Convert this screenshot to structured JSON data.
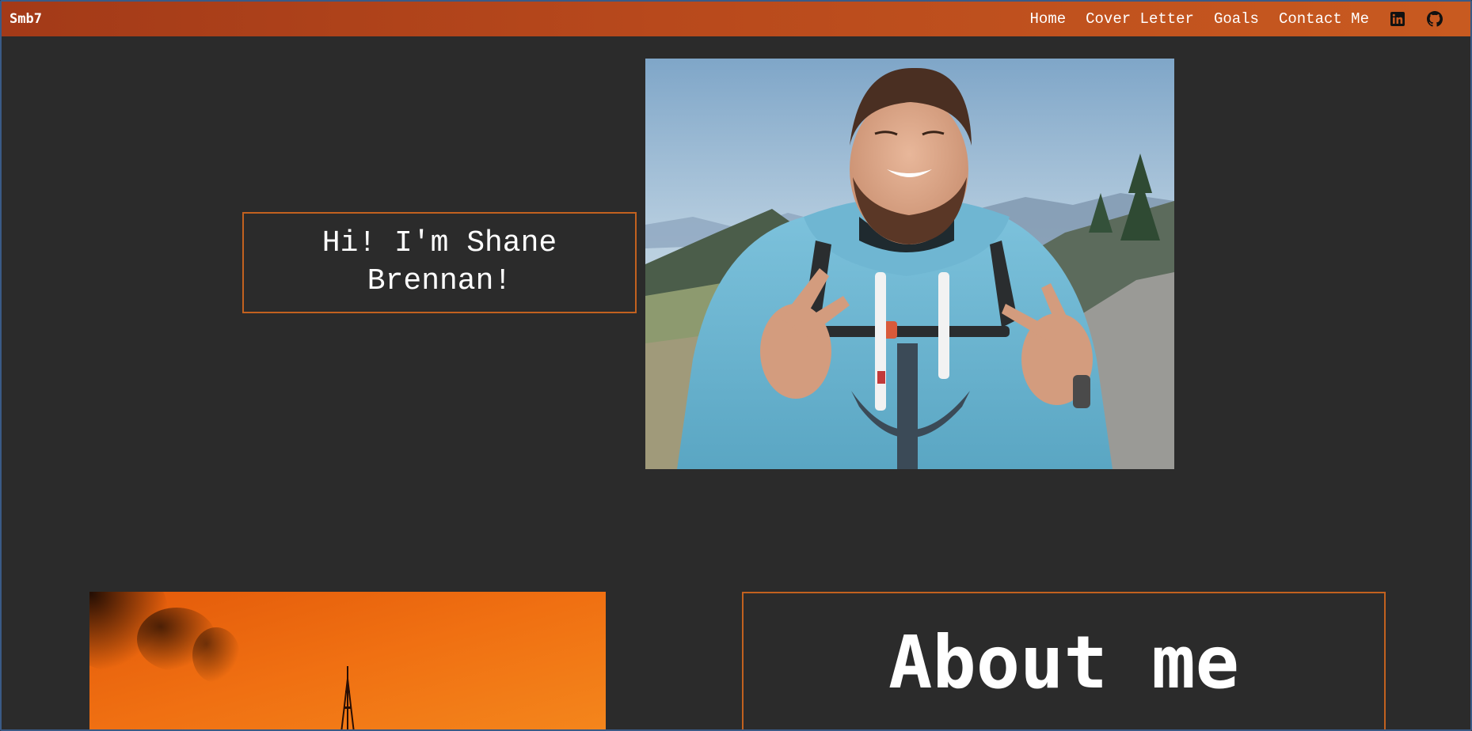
{
  "navbar": {
    "brand": "Smb7",
    "links": [
      "Home",
      "Cover Letter",
      "Goals",
      "Contact Me"
    ],
    "icons": [
      "linkedin-icon",
      "github-icon"
    ]
  },
  "hero": {
    "greeting": "Hi! I'm Shane Brennan!"
  },
  "about": {
    "title": "About me"
  },
  "colors": {
    "background": "#2b2b2b",
    "nav_start": "#a33a18",
    "nav_end": "#c85a20",
    "accent_border": "#c2611f",
    "text": "#ffffff"
  }
}
